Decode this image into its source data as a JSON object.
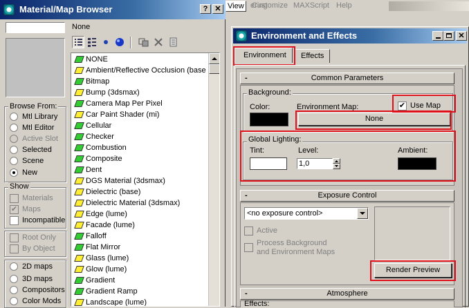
{
  "max_menu": {
    "items": [
      "View",
      "ering",
      "Customize",
      "MAXScript",
      "Help"
    ]
  },
  "browser": {
    "title": "Material/Map Browser",
    "help_btn": "?",
    "close_btn": "✕",
    "search_value": "",
    "selected_name": "None",
    "browse_from": {
      "label": "Browse From:",
      "options": [
        {
          "label": "Mtl Library",
          "selected": false,
          "enabled": true
        },
        {
          "label": "Mtl Editor",
          "selected": false,
          "enabled": true
        },
        {
          "label": "Active Slot",
          "selected": false,
          "enabled": false
        },
        {
          "label": "Selected",
          "selected": false,
          "enabled": true
        },
        {
          "label": "Scene",
          "selected": false,
          "enabled": true
        },
        {
          "label": "New",
          "selected": true,
          "enabled": true
        }
      ]
    },
    "show": {
      "label": "Show",
      "options": [
        {
          "label": "Materials",
          "checked": false,
          "enabled": false
        },
        {
          "label": "Maps",
          "checked": true,
          "enabled": false
        },
        {
          "label": "Incompatible",
          "checked": false,
          "enabled": true
        }
      ]
    },
    "root_options": [
      {
        "label": "Root Only",
        "checked": false
      },
      {
        "label": "By Object",
        "checked": false
      }
    ],
    "map_types": [
      {
        "label": "2D maps",
        "selected": false
      },
      {
        "label": "3D maps",
        "selected": false
      },
      {
        "label": "Compositors",
        "selected": false
      },
      {
        "label": "Color Mods",
        "selected": false
      }
    ],
    "list": [
      {
        "label": "NONE",
        "icon": "g"
      },
      {
        "label": "Ambient/Reflective Occlusion (base",
        "icon": "y"
      },
      {
        "label": "Bitmap",
        "icon": "g"
      },
      {
        "label": "Bump (3dsmax)",
        "icon": "y"
      },
      {
        "label": "Camera Map Per Pixel",
        "icon": "g"
      },
      {
        "label": "Car Paint Shader (mi)",
        "icon": "y"
      },
      {
        "label": "Cellular",
        "icon": "g"
      },
      {
        "label": "Checker",
        "icon": "g"
      },
      {
        "label": "Combustion",
        "icon": "g"
      },
      {
        "label": "Composite",
        "icon": "g"
      },
      {
        "label": "Dent",
        "icon": "g"
      },
      {
        "label": "DGS Material (3dsmax)",
        "icon": "y"
      },
      {
        "label": "Dielectric (base)",
        "icon": "y"
      },
      {
        "label": "Dielectric Material (3dsmax)",
        "icon": "y"
      },
      {
        "label": "Edge (lume)",
        "icon": "y"
      },
      {
        "label": "Facade (lume)",
        "icon": "y"
      },
      {
        "label": "Falloff",
        "icon": "g"
      },
      {
        "label": "Flat Mirror",
        "icon": "g"
      },
      {
        "label": "Glass (lume)",
        "icon": "y"
      },
      {
        "label": "Glow (lume)",
        "icon": "y"
      },
      {
        "label": "Gradient",
        "icon": "g"
      },
      {
        "label": "Gradient Ramp",
        "icon": "g"
      },
      {
        "label": "Landscape (lume)",
        "icon": "y"
      }
    ]
  },
  "env": {
    "title": "Environment and Effects",
    "tabs": [
      "Environment",
      "Effects"
    ],
    "common": {
      "title": "Common Parameters",
      "minus": "-",
      "background_label": "Background:",
      "color_label": "Color:",
      "env_map_label": "Environment Map:",
      "use_map_label": "Use Map",
      "use_map_checked": "✔",
      "env_map_button": "None",
      "global_lighting_label": "Global Lighting:",
      "tint_label": "Tint:",
      "level_label": "Level:",
      "level_value": "1,0",
      "ambient_label": "Ambient:",
      "bg_color": "#000000",
      "tint_color": "#ffffff",
      "ambient_color": "#000000"
    },
    "exposure": {
      "title": "Exposure Control",
      "minus": "-",
      "dropdown_value": "<no exposure control>",
      "active_label": "Active",
      "process_line1": "Process Background",
      "process_line2": "and Environment Maps",
      "render_preview": "Render Preview"
    },
    "atmosphere": {
      "title": "Atmosphere",
      "minus": "-",
      "effects_label": "Effects:"
    }
  },
  "colors": {
    "highlight": "#e0101a",
    "title_start": "#0a246a",
    "title_end": "#a6caf0"
  }
}
